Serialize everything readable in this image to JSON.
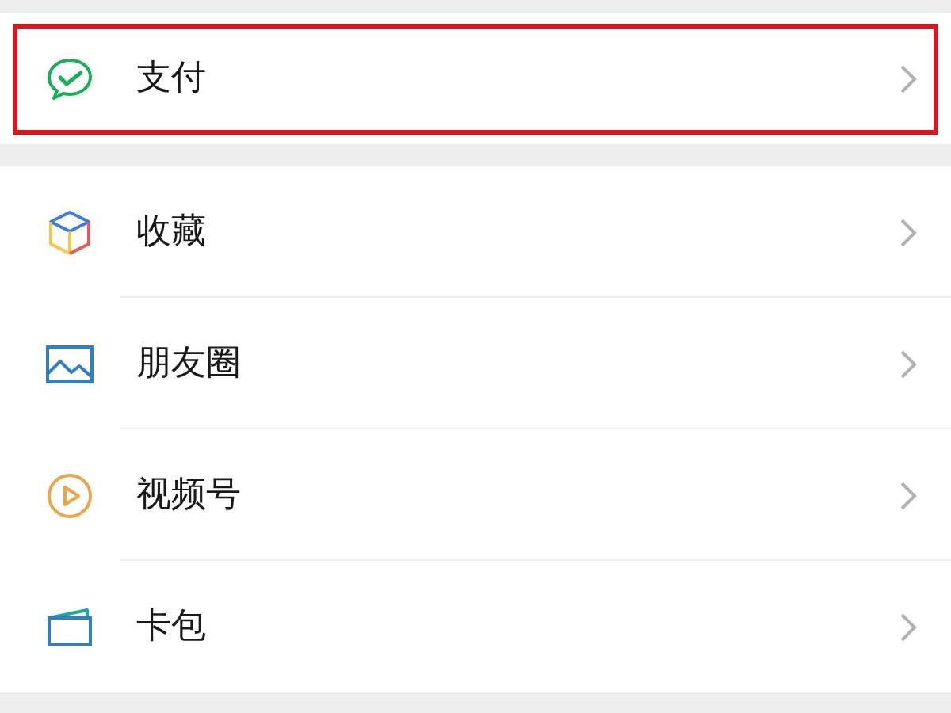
{
  "sections": [
    {
      "items": [
        {
          "kind": "pay",
          "label": "支付",
          "highlighted": true
        }
      ]
    },
    {
      "items": [
        {
          "kind": "favorites",
          "label": "收藏",
          "highlighted": false
        },
        {
          "kind": "moments",
          "label": "朋友圈",
          "highlighted": false
        },
        {
          "kind": "channels",
          "label": "视频号",
          "highlighted": false
        },
        {
          "kind": "cards",
          "label": "卡包",
          "highlighted": false
        }
      ]
    }
  ]
}
